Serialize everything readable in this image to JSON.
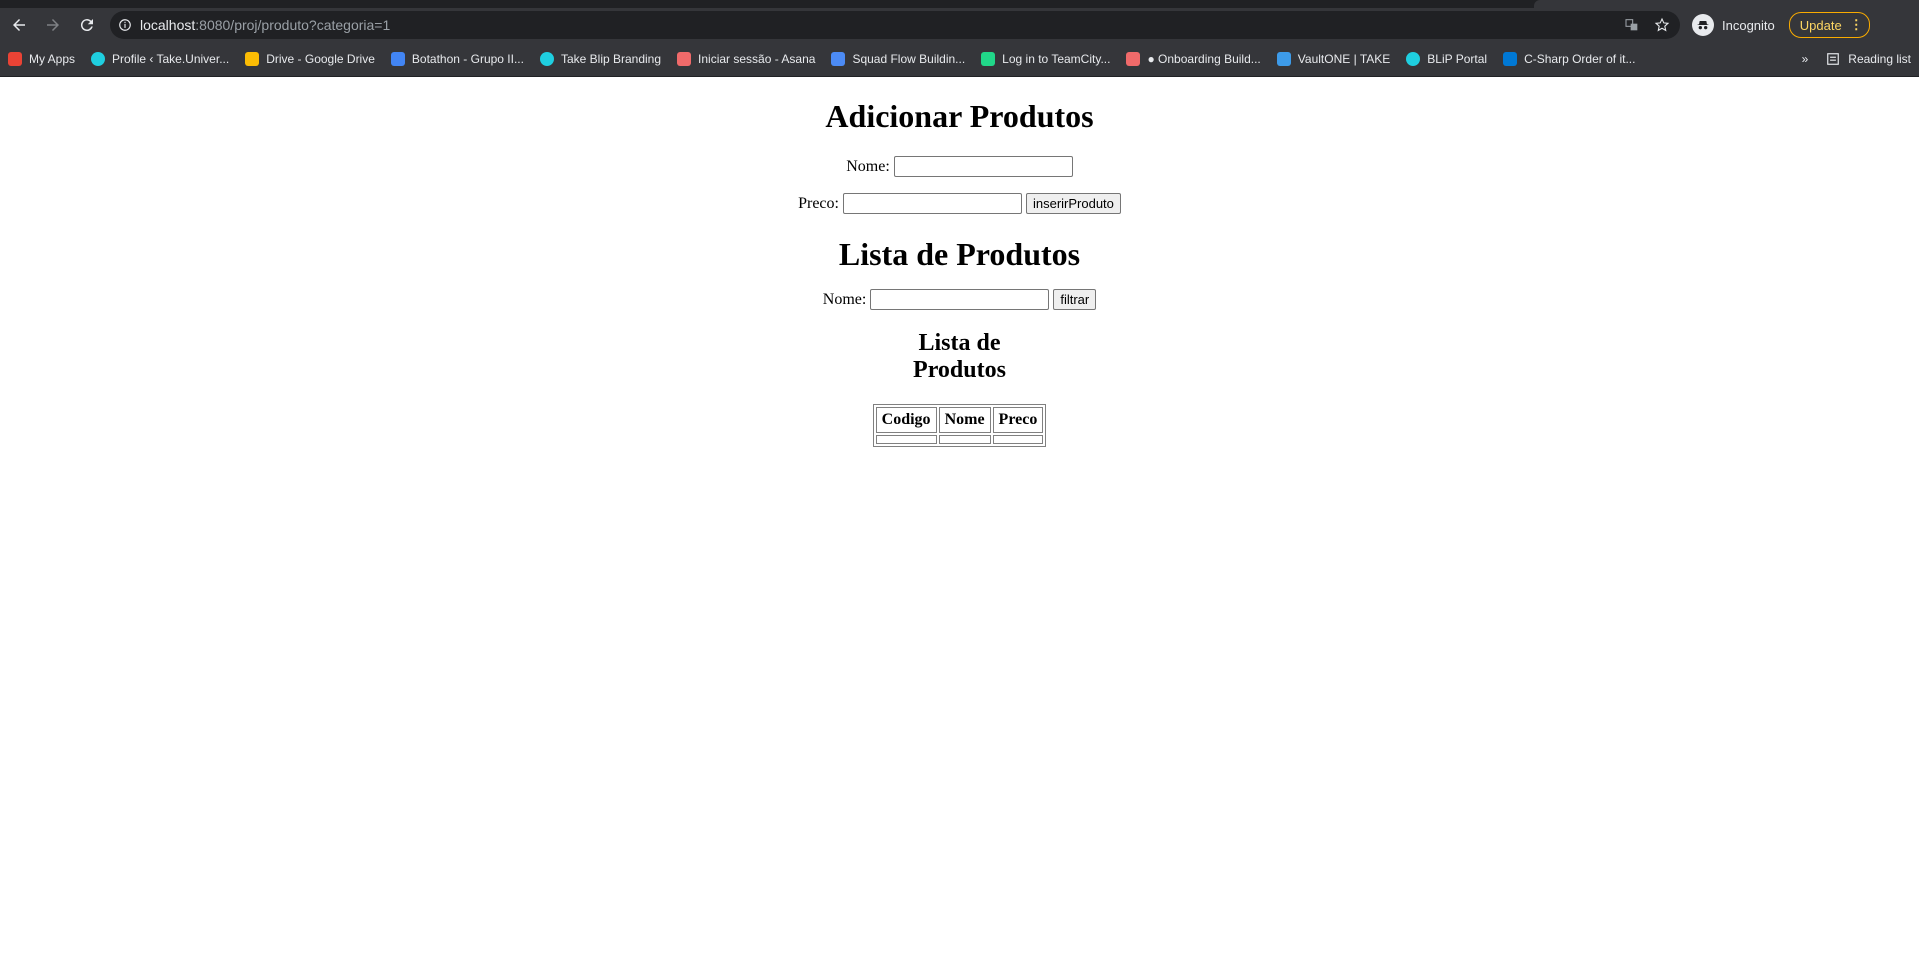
{
  "browser": {
    "url_host": "localhost",
    "url_rest": ":8080/proj/produto?categoria=1",
    "incognito_label": "Incognito",
    "update_label": "Update",
    "bookmarks": [
      {
        "label": "My Apps",
        "icon": "apps-grid-icon",
        "color": "#ea4335"
      },
      {
        "label": "Profile ‹ Take.Univer...",
        "icon": "take-icon",
        "color": "#1fcfe0"
      },
      {
        "label": "Drive - Google Drive",
        "icon": "google-drive-icon",
        "color": "#fbbc04"
      },
      {
        "label": "Botathon - Grupo II...",
        "icon": "google-docs-icon",
        "color": "#4285f4"
      },
      {
        "label": "Take Blip Branding",
        "icon": "take-icon",
        "color": "#1fcfe0"
      },
      {
        "label": "Iniciar sessão - Asana",
        "icon": "asana-icon",
        "color": "#f06a6a"
      },
      {
        "label": "Squad Flow Buildin...",
        "icon": "people-icon",
        "color": "#4c8bf5"
      },
      {
        "label": "Log in to TeamCity...",
        "icon": "teamcity-icon",
        "color": "#21d789"
      },
      {
        "label": "● Onboarding Build...",
        "icon": "asana-icon",
        "color": "#f06a6a"
      },
      {
        "label": "VaultONE | TAKE",
        "icon": "vault-icon",
        "color": "#3d9be9"
      },
      {
        "label": "BLiP Portal",
        "icon": "take-icon",
        "color": "#1fcfe0"
      },
      {
        "label": "C-Sharp Order of it...",
        "icon": "azure-devops-icon",
        "color": "#0078d4"
      }
    ],
    "reading_list_label": "Reading list"
  },
  "page": {
    "add_title": "Adicionar Produtos",
    "name_label": "Nome:",
    "price_label": "Preco:",
    "insert_button": "inserirProduto",
    "list_title": "Lista de Produtos",
    "filter_name_label": "Nome:",
    "filter_button": "filtrar",
    "table_caption": "Lista de Produtos",
    "table_headers": [
      "Codigo",
      "Nome",
      "Preco"
    ]
  }
}
